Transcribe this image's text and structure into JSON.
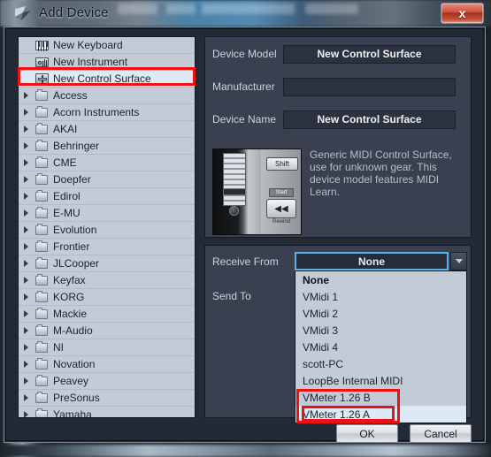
{
  "window": {
    "title": "Add Device",
    "title_icon": "app-icon",
    "close_label": "x"
  },
  "tree": {
    "items": [
      {
        "label": "New Keyboard",
        "icon": "keyboard-icon",
        "expandable": false,
        "selected": false
      },
      {
        "label": "New Instrument",
        "icon": "instrument-icon",
        "expandable": false,
        "selected": false
      },
      {
        "label": "New Control Surface",
        "icon": "control-surface-icon",
        "expandable": false,
        "selected": true
      },
      {
        "label": "Access",
        "icon": "folder-icon",
        "expandable": true,
        "selected": false
      },
      {
        "label": "Acorn Instruments",
        "icon": "folder-icon",
        "expandable": true,
        "selected": false
      },
      {
        "label": "AKAI",
        "icon": "folder-icon",
        "expandable": true,
        "selected": false
      },
      {
        "label": "Behringer",
        "icon": "folder-icon",
        "expandable": true,
        "selected": false
      },
      {
        "label": "CME",
        "icon": "folder-icon",
        "expandable": true,
        "selected": false
      },
      {
        "label": "Doepfer",
        "icon": "folder-icon",
        "expandable": true,
        "selected": false
      },
      {
        "label": "Edirol",
        "icon": "folder-icon",
        "expandable": true,
        "selected": false
      },
      {
        "label": "E-MU",
        "icon": "folder-icon",
        "expandable": true,
        "selected": false
      },
      {
        "label": "Evolution",
        "icon": "folder-icon",
        "expandable": true,
        "selected": false
      },
      {
        "label": "Frontier",
        "icon": "folder-icon",
        "expandable": true,
        "selected": false
      },
      {
        "label": "JLCooper",
        "icon": "folder-icon",
        "expandable": true,
        "selected": false
      },
      {
        "label": "Keyfax",
        "icon": "folder-icon",
        "expandable": true,
        "selected": false
      },
      {
        "label": "KORG",
        "icon": "folder-icon",
        "expandable": true,
        "selected": false
      },
      {
        "label": "Mackie",
        "icon": "folder-icon",
        "expandable": true,
        "selected": false
      },
      {
        "label": "M-Audio",
        "icon": "folder-icon",
        "expandable": true,
        "selected": false
      },
      {
        "label": "NI",
        "icon": "folder-icon",
        "expandable": true,
        "selected": false
      },
      {
        "label": "Novation",
        "icon": "folder-icon",
        "expandable": true,
        "selected": false
      },
      {
        "label": "Peavey",
        "icon": "folder-icon",
        "expandable": true,
        "selected": false
      },
      {
        "label": "PreSonus",
        "icon": "folder-icon",
        "expandable": true,
        "selected": false
      },
      {
        "label": "Yamaha",
        "icon": "folder-icon",
        "expandable": true,
        "selected": false
      }
    ]
  },
  "info": {
    "fields": [
      {
        "label": "Device Model",
        "value": "New Control Surface"
      },
      {
        "label": "Manufacturer",
        "value": ""
      },
      {
        "label": "Device Name",
        "value": "New Control Surface"
      }
    ],
    "photo": {
      "shift_label": "Shift",
      "start_label": "Start",
      "rewind_glyph": "◀◀",
      "rewind_label": "Rewind"
    },
    "description": "Generic MIDI Control Surface, use for unknown gear. This device model features MIDI Learn."
  },
  "routing": {
    "receive_label": "Receive From",
    "send_label": "Send To",
    "combo_value": "None",
    "options": [
      {
        "label": "None",
        "bold": true,
        "highlighted": false
      },
      {
        "label": "VMidi 1",
        "bold": false,
        "highlighted": false
      },
      {
        "label": "VMidi 2",
        "bold": false,
        "highlighted": false
      },
      {
        "label": "VMidi 3",
        "bold": false,
        "highlighted": false
      },
      {
        "label": "VMidi 4",
        "bold": false,
        "highlighted": false
      },
      {
        "label": "scott-PC",
        "bold": false,
        "highlighted": false
      },
      {
        "label": "LoopBe Internal MIDI",
        "bold": false,
        "highlighted": false
      },
      {
        "label": "VMeter 1.26 B",
        "bold": false,
        "highlighted": false
      },
      {
        "label": "VMeter 1.26 A",
        "bold": false,
        "highlighted": true
      }
    ]
  },
  "buttons": {
    "ok": "OK",
    "cancel": "Cancel"
  },
  "annotations": {
    "highlight_color": "#ee1111",
    "boxes": [
      "new-control-surface-row",
      "vmeter-option-pair",
      "vmeter-a-option"
    ]
  }
}
